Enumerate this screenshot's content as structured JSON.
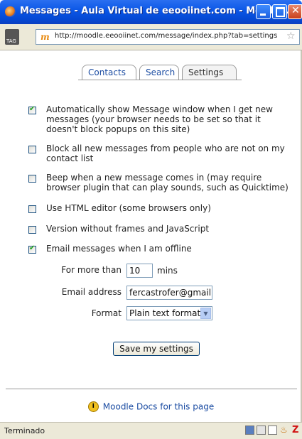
{
  "window": {
    "title": "Messages - Aula Virtual de eeooiinet.com - Mozilla ...",
    "url": "http://moodle.eeooiinet.com/message/index.php?tab=settings",
    "tag_label": "TAG",
    "favicon_letter": "m"
  },
  "tabs": [
    {
      "label": "Contacts",
      "active": false
    },
    {
      "label": "Search",
      "active": false
    },
    {
      "label": "Settings",
      "active": true
    }
  ],
  "options": [
    {
      "label": "Automatically show Message window when I get new messages (your browser needs to be set so that it doesn't block popups on this site)",
      "checked": true
    },
    {
      "label": "Block all new messages from people who are not on my contact list",
      "checked": false
    },
    {
      "label": "Beep when a new message comes in (may require browser plugin that can play sounds, such as Quicktime)",
      "checked": false
    },
    {
      "label": "Use HTML editor (some browsers only)",
      "checked": false
    },
    {
      "label": "Version without frames and JavaScript",
      "checked": false
    },
    {
      "label": "Email messages when I am offline",
      "checked": true
    }
  ],
  "email_settings": {
    "for_more_than_label": "For more than",
    "for_more_than_value": "10",
    "mins_label": "mins",
    "email_label": "Email address",
    "email_value": "fercastrofer@gmail.com",
    "format_label": "Format",
    "format_value": "Plain text format"
  },
  "save_label": "Save my settings",
  "docs_link": "Moodle Docs for this page",
  "status": "Terminado",
  "colors": {
    "link": "#1b4ca2",
    "titlebar": "#0a56e6"
  }
}
